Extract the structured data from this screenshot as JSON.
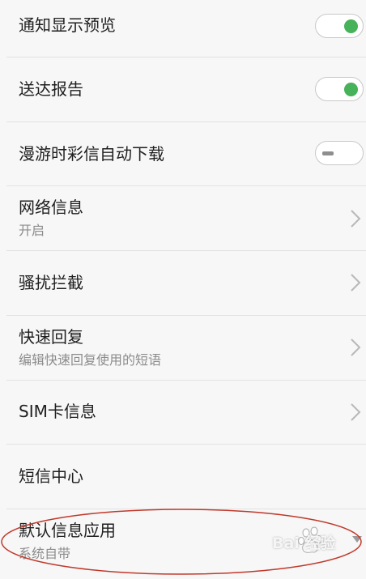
{
  "settings": {
    "notification_preview": {
      "title": "通知显示预览",
      "enabled": true
    },
    "delivery_report": {
      "title": "送达报告",
      "enabled": true
    },
    "roaming_mms_download": {
      "title": "漫游时彩信自动下载",
      "enabled": false
    },
    "network_info": {
      "title": "网络信息",
      "subtitle": "开启"
    },
    "harassment_block": {
      "title": "骚扰拦截"
    },
    "quick_reply": {
      "title": "快速回复",
      "subtitle": "编辑快速回复使用的短语"
    },
    "sim_info": {
      "title": "SIM卡信息"
    },
    "sms_center": {
      "title": "短信中心"
    },
    "default_app": {
      "title": "默认信息应用",
      "subtitle": "系统自带"
    }
  },
  "colors": {
    "background": "#f7f7f7",
    "divider": "#e2e2e2",
    "toggle_on": "#46b25a",
    "highlight_circle": "#c0392b",
    "chevron": "#b8b8b8"
  },
  "watermark": {
    "text": "Bai 经验"
  }
}
